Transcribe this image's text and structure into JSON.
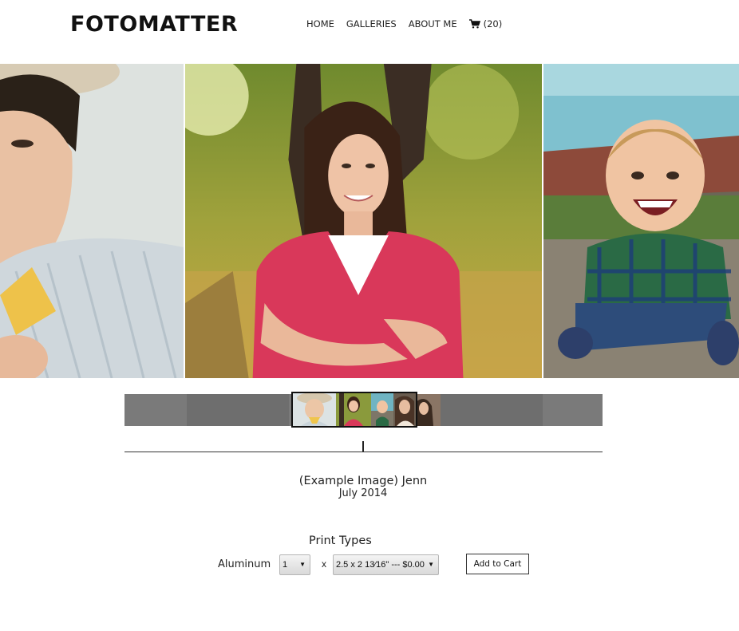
{
  "site": {
    "logo": "FOTOMATTER"
  },
  "nav": {
    "home": "HOME",
    "galleries": "GALLERIES",
    "about": "ABOUT ME",
    "cart_count": "(20)"
  },
  "caption": {
    "title": "(Example Image) Jenn",
    "date": "July 2014"
  },
  "purchase": {
    "heading": "Print Types",
    "print_type": "Aluminum",
    "quantity": "1",
    "times": "x",
    "size_option": "2.5 x 2 13⁄16\" --- $0.00",
    "add_to_cart": "Add to Cart"
  },
  "colors": {
    "accent": "#111111",
    "strip": "#7a7a7a"
  }
}
